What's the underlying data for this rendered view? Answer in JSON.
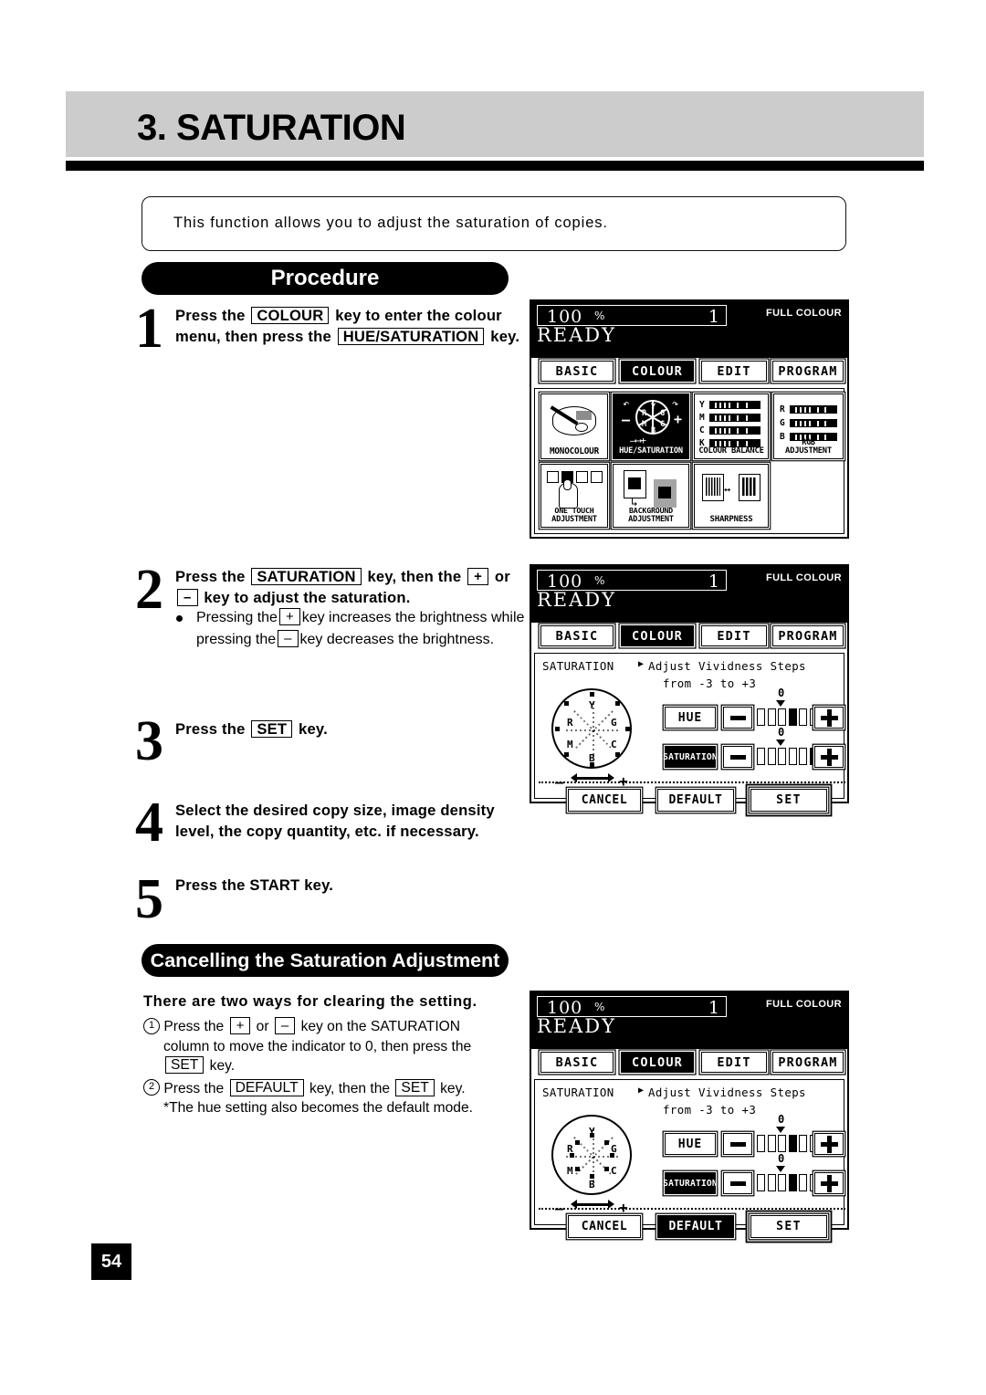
{
  "header": {
    "title": "3. SATURATION"
  },
  "intro": {
    "text": "This function allows you to adjust the saturation of copies."
  },
  "banners": {
    "procedure": "Procedure",
    "cancelling": "Cancelling the Saturation Adjustment"
  },
  "steps": [
    {
      "num": "1",
      "line1_a": "Press the",
      "key1": "COLOUR",
      "line1_b": "key to enter the colour",
      "line2_a": "menu, then press the",
      "key2": "HUE/SATURATION",
      "line3": "key."
    },
    {
      "num": "2",
      "line1_a": "Press the",
      "key1": "SATURATION",
      "line1_b": "key, then the",
      "key2": "+",
      "line2_a": "or",
      "key3": "–",
      "line2_b": "key to adjust the saturation.",
      "bullet_a": "Pressing the",
      "bullet_key1": "+",
      "bullet_b": "key increases the brightness",
      "bullet_c": "while pressing the",
      "bullet_key2": "–",
      "bullet_d": "key decreases the",
      "bullet_e": "brightness."
    },
    {
      "num": "3",
      "line1_a": "Press the",
      "key1": "SET",
      "line1_b": "key."
    },
    {
      "num": "4",
      "line1": "Select the desired copy size, image density",
      "line2": "level, the copy quantity, etc. if necessary."
    },
    {
      "num": "5",
      "line1": "Press the START key."
    }
  ],
  "cancelling": {
    "heading": "There are two ways for clearing the setting.",
    "item1": {
      "marker": "1",
      "a": "Press the",
      "key_plus": "+",
      "b": "or",
      "key_minus": "–",
      "c": "key on the SATURATION",
      "d": "column to move the indicator to 0, then press the",
      "key_set": "SET",
      "e": "key."
    },
    "item2": {
      "marker": "2",
      "a": "Press the",
      "key_default": "DEFAULT",
      "b": "key, then the",
      "key_set": "SET",
      "c": "key.",
      "note": "*The hue setting also becomes the default mode."
    }
  },
  "page_number": "54",
  "lcd_common": {
    "zoom": "100",
    "percent": "%",
    "quantity": "1",
    "mode": "FULL COLOUR",
    "ready": "READY",
    "tabs": [
      "BASIC",
      "COLOUR",
      "EDIT",
      "PROGRAM"
    ],
    "active_tab": "COLOUR"
  },
  "panel1": {
    "cells": [
      {
        "label": "MONOCOLOUR",
        "icon": "palette-icon",
        "selected": false
      },
      {
        "label": "HUE/SATURATION",
        "icon": "colour-wheel-icon",
        "selected": true
      },
      {
        "label": "COLOUR BALANCE",
        "icon": "ymck-bars-icon",
        "selected": false
      },
      {
        "label_top": "RGB",
        "label": "ADJUSTMENT",
        "icon": "rgb-bars-icon",
        "selected": false
      },
      {
        "label_top": "ONE  TOUCH",
        "label": "ADJUSTMENT",
        "icon": "one-touch-icon",
        "selected": false
      },
      {
        "label_top": "BACKGROUND",
        "label": "ADJUSTMENT",
        "icon": "background-icon",
        "selected": false
      },
      {
        "label": "SHARPNESS",
        "icon": "sharpness-icon",
        "selected": false
      }
    ],
    "wheel_labels": [
      "Y",
      "G",
      "C",
      "B",
      "M",
      "R"
    ],
    "balance_labels": [
      "Y",
      "M",
      "C",
      "K"
    ],
    "rgb_labels": [
      "R",
      "G",
      "B"
    ]
  },
  "panel2": {
    "title": "SATURATION",
    "pointer": "▶",
    "subtitle1": "Adjust Vividness Steps",
    "subtitle2": "from -3 to +3",
    "wheel_labels": [
      "Y",
      "R",
      "G",
      "M",
      "C",
      "B"
    ],
    "wheel_minus": "–",
    "wheel_plus": "+",
    "rows": [
      {
        "name": "HUE",
        "selected": false,
        "zero": "0",
        "segments": 7,
        "indicator": 4
      },
      {
        "name": "SATURATION",
        "selected": true,
        "zero": "0",
        "segments": 7,
        "indicator": 6
      }
    ],
    "footer": [
      {
        "label": "CANCEL",
        "selected": false,
        "emphasis": false
      },
      {
        "label": "DEFAULT",
        "selected": false,
        "emphasis": false
      },
      {
        "label": "SET",
        "selected": false,
        "emphasis": true
      }
    ]
  },
  "panel3": {
    "title": "SATURATION",
    "pointer": "▶",
    "subtitle1": "Adjust Vividness Steps",
    "subtitle2": "from -3 to +3",
    "wheel_labels": [
      "Y",
      "R",
      "G",
      "M",
      "C",
      "B"
    ],
    "wheel_minus": "–",
    "wheel_plus": "+",
    "rows": [
      {
        "name": "HUE",
        "selected": false,
        "zero": "0",
        "segments": 7,
        "indicator": 4
      },
      {
        "name": "SATURATION",
        "selected": true,
        "zero": "0",
        "segments": 7,
        "indicator": 4
      }
    ],
    "footer": [
      {
        "label": "CANCEL",
        "selected": false,
        "emphasis": false
      },
      {
        "label": "DEFAULT",
        "selected": true,
        "emphasis": false
      },
      {
        "label": "SET",
        "selected": false,
        "emphasis": true
      }
    ]
  },
  "colors": {
    "header_band": "#cccccc",
    "ink": "#000000",
    "paper": "#ffffff"
  }
}
